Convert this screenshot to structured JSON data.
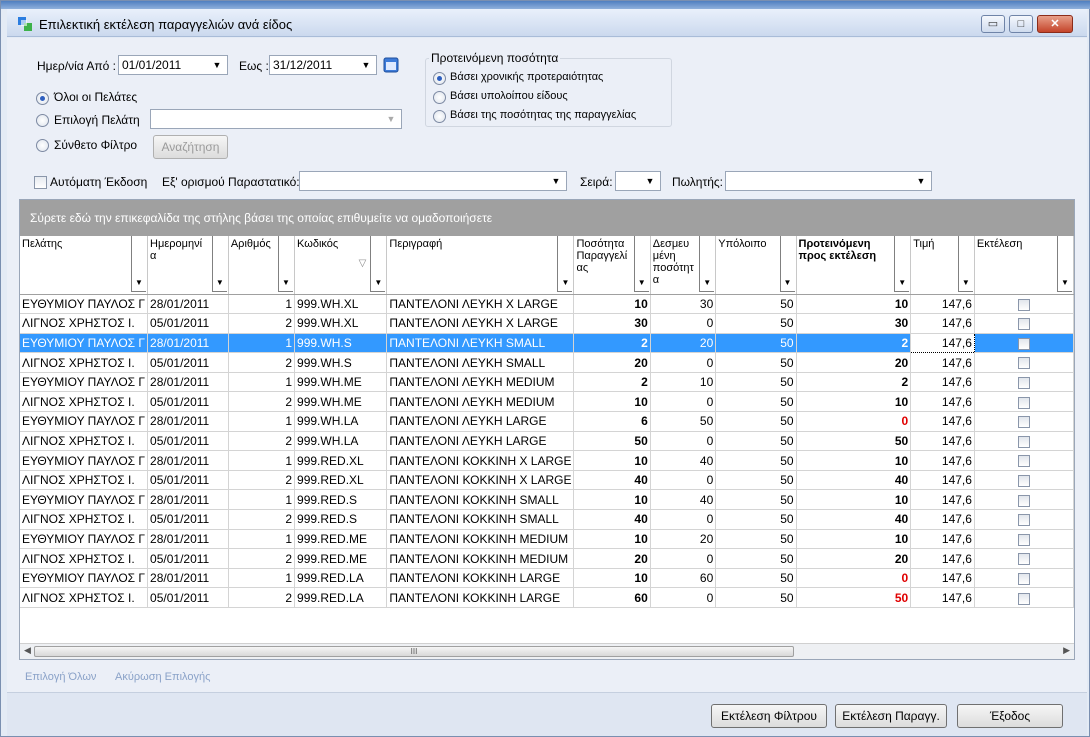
{
  "window": {
    "title": "Επιλεκτική εκτέλεση παραγγελιών ανά είδος",
    "buttons": {
      "minimize": "▭",
      "maximize": "□",
      "close": "✕"
    }
  },
  "filters": {
    "date_from_label": "Ημερ/νία Από :",
    "date_from": "01/01/2011",
    "date_to_label": "Εως :",
    "date_to": "31/12/2011",
    "customer_options": [
      {
        "label": "Όλοι οι Πελάτες",
        "selected": true
      },
      {
        "label": "Επιλογή Πελάτη",
        "selected": false
      },
      {
        "label": "Σύνθετο Φίλτρο",
        "selected": false
      }
    ],
    "customer_select": "",
    "search_button": "Αναζήτηση",
    "auto_issue_label": "Αυτόματη Έκδοση",
    "doc_label": "Εξ' ορισμού Παραστατικό:",
    "doc_value": "",
    "series_label": "Σειρά:",
    "series_value": "",
    "seller_label": "Πωλητής:",
    "seller_value": ""
  },
  "proposed_qty": {
    "legend": "Προτεινόμενη ποσότητα",
    "options": [
      {
        "label": "Βάσει χρονικής προτεραιότητας",
        "selected": true
      },
      {
        "label": "Βάσει υπολοίπου είδους",
        "selected": false
      },
      {
        "label": "Βάσει της ποσότητας της παραγγελίας",
        "selected": false
      }
    ]
  },
  "grid": {
    "group_hint": "Σύρετε εδώ την επικεφαλίδα της στήλης βάσει της οποίας επιθυμείτε να ομαδοποιήσετε",
    "columns": [
      "Πελάτης",
      "Ημερομηνί α",
      "Αριθμός",
      "Κωδικός",
      "Περιγραφή",
      "Ποσότητα Παραγγελί ας",
      "Δεσμευ μένη ποσότητ α",
      "Υπόλοιπο",
      "Προτεινόμενη προς εκτέλεση",
      "Τιμή",
      "Εκτέλεση"
    ],
    "sort_indicator": "▽",
    "rows": [
      {
        "customer": "ΕΥΘΥΜΙΟΥ ΠΑΥΛΟΣ Γ",
        "date": "28/01/2011",
        "num": "1",
        "code": "999.WH.XL",
        "desc": "ΠΑΝΤΕΛΟΝΙ ΛΕΥΚΗ X LARGE",
        "qty": "10",
        "reserved": "30",
        "balance": "50",
        "proposed": "10",
        "price": "147,6",
        "proposed_red": false,
        "selected": false
      },
      {
        "customer": "ΛΙΓΝΟΣ ΧΡΗΣΤΟΣ Ι.",
        "date": "05/01/2011",
        "num": "2",
        "code": "999.WH.XL",
        "desc": "ΠΑΝΤΕΛΟΝΙ ΛΕΥΚΗ X LARGE",
        "qty": "30",
        "reserved": "0",
        "balance": "50",
        "proposed": "30",
        "price": "147,6",
        "proposed_red": false,
        "selected": false
      },
      {
        "customer": "ΕΥΘΥΜΙΟΥ ΠΑΥΛΟΣ Γ",
        "date": "28/01/2011",
        "num": "1",
        "code": "999.WH.S",
        "desc": "ΠΑΝΤΕΛΟΝΙ ΛΕΥΚΗ SMALL",
        "qty": "2",
        "reserved": "20",
        "balance": "50",
        "proposed": "2",
        "price": "147,6",
        "proposed_red": false,
        "selected": true
      },
      {
        "customer": "ΛΙΓΝΟΣ ΧΡΗΣΤΟΣ Ι.",
        "date": "05/01/2011",
        "num": "2",
        "code": "999.WH.S",
        "desc": "ΠΑΝΤΕΛΟΝΙ ΛΕΥΚΗ SMALL",
        "qty": "20",
        "reserved": "0",
        "balance": "50",
        "proposed": "20",
        "price": "147,6",
        "proposed_red": false,
        "selected": false
      },
      {
        "customer": "ΕΥΘΥΜΙΟΥ ΠΑΥΛΟΣ Γ",
        "date": "28/01/2011",
        "num": "1",
        "code": "999.WH.ME",
        "desc": "ΠΑΝΤΕΛΟΝΙ ΛΕΥΚΗ MEDIUM",
        "qty": "2",
        "reserved": "10",
        "balance": "50",
        "proposed": "2",
        "price": "147,6",
        "proposed_red": false,
        "selected": false
      },
      {
        "customer": "ΛΙΓΝΟΣ ΧΡΗΣΤΟΣ Ι.",
        "date": "05/01/2011",
        "num": "2",
        "code": "999.WH.ME",
        "desc": "ΠΑΝΤΕΛΟΝΙ ΛΕΥΚΗ MEDIUM",
        "qty": "10",
        "reserved": "0",
        "balance": "50",
        "proposed": "10",
        "price": "147,6",
        "proposed_red": false,
        "selected": false
      },
      {
        "customer": "ΕΥΘΥΜΙΟΥ ΠΑΥΛΟΣ Γ",
        "date": "28/01/2011",
        "num": "1",
        "code": "999.WH.LA",
        "desc": "ΠΑΝΤΕΛΟΝΙ ΛΕΥΚΗ LARGE",
        "qty": "6",
        "reserved": "50",
        "balance": "50",
        "proposed": "0",
        "price": "147,6",
        "proposed_red": true,
        "selected": false
      },
      {
        "customer": "ΛΙΓΝΟΣ ΧΡΗΣΤΟΣ Ι.",
        "date": "05/01/2011",
        "num": "2",
        "code": "999.WH.LA",
        "desc": "ΠΑΝΤΕΛΟΝΙ ΛΕΥΚΗ LARGE",
        "qty": "50",
        "reserved": "0",
        "balance": "50",
        "proposed": "50",
        "price": "147,6",
        "proposed_red": false,
        "selected": false
      },
      {
        "customer": "ΕΥΘΥΜΙΟΥ ΠΑΥΛΟΣ Γ",
        "date": "28/01/2011",
        "num": "1",
        "code": "999.RED.XL",
        "desc": "ΠΑΝΤΕΛΟΝΙ ΚΟΚΚΙΝΗ X LARGE",
        "qty": "10",
        "reserved": "40",
        "balance": "50",
        "proposed": "10",
        "price": "147,6",
        "proposed_red": false,
        "selected": false
      },
      {
        "customer": "ΛΙΓΝΟΣ ΧΡΗΣΤΟΣ Ι.",
        "date": "05/01/2011",
        "num": "2",
        "code": "999.RED.XL",
        "desc": "ΠΑΝΤΕΛΟΝΙ ΚΟΚΚΙΝΗ X LARGE",
        "qty": "40",
        "reserved": "0",
        "balance": "50",
        "proposed": "40",
        "price": "147,6",
        "proposed_red": false,
        "selected": false
      },
      {
        "customer": "ΕΥΘΥΜΙΟΥ ΠΑΥΛΟΣ Γ",
        "date": "28/01/2011",
        "num": "1",
        "code": "999.RED.S",
        "desc": "ΠΑΝΤΕΛΟΝΙ ΚΟΚΚΙΝΗ SMALL",
        "qty": "10",
        "reserved": "40",
        "balance": "50",
        "proposed": "10",
        "price": "147,6",
        "proposed_red": false,
        "selected": false
      },
      {
        "customer": "ΛΙΓΝΟΣ ΧΡΗΣΤΟΣ Ι.",
        "date": "05/01/2011",
        "num": "2",
        "code": "999.RED.S",
        "desc": "ΠΑΝΤΕΛΟΝΙ ΚΟΚΚΙΝΗ SMALL",
        "qty": "40",
        "reserved": "0",
        "balance": "50",
        "proposed": "40",
        "price": "147,6",
        "proposed_red": false,
        "selected": false
      },
      {
        "customer": "ΕΥΘΥΜΙΟΥ ΠΑΥΛΟΣ Γ",
        "date": "28/01/2011",
        "num": "1",
        "code": "999.RED.ME",
        "desc": "ΠΑΝΤΕΛΟΝΙ ΚΟΚΚΙΝΗ MEDIUM",
        "qty": "10",
        "reserved": "20",
        "balance": "50",
        "proposed": "10",
        "price": "147,6",
        "proposed_red": false,
        "selected": false
      },
      {
        "customer": "ΛΙΓΝΟΣ ΧΡΗΣΤΟΣ Ι.",
        "date": "05/01/2011",
        "num": "2",
        "code": "999.RED.ME",
        "desc": "ΠΑΝΤΕΛΟΝΙ ΚΟΚΚΙΝΗ MEDIUM",
        "qty": "20",
        "reserved": "0",
        "balance": "50",
        "proposed": "20",
        "price": "147,6",
        "proposed_red": false,
        "selected": false
      },
      {
        "customer": "ΕΥΘΥΜΙΟΥ ΠΑΥΛΟΣ Γ",
        "date": "28/01/2011",
        "num": "1",
        "code": "999.RED.LA",
        "desc": "ΠΑΝΤΕΛΟΝΙ ΚΟΚΚΙΝΗ LARGE",
        "qty": "10",
        "reserved": "60",
        "balance": "50",
        "proposed": "0",
        "price": "147,6",
        "proposed_red": true,
        "selected": false
      },
      {
        "customer": "ΛΙΓΝΟΣ ΧΡΗΣΤΟΣ Ι.",
        "date": "05/01/2011",
        "num": "2",
        "code": "999.RED.LA",
        "desc": "ΠΑΝΤΕΛΟΝΙ ΚΟΚΚΙΝΗ LARGE",
        "qty": "60",
        "reserved": "0",
        "balance": "50",
        "proposed": "50",
        "price": "147,6",
        "proposed_red": true,
        "selected": false
      }
    ],
    "scroll_grip": "III"
  },
  "links": {
    "select_all": "Επιλογή Όλων",
    "cancel_selection": "Ακύρωση Επιλογής"
  },
  "actions": {
    "run_filter": "Εκτέλεση Φίλτρου",
    "run_order": "Εκτέλεση Παραγγ.",
    "exit": "Έξοδος"
  },
  "colors": {
    "selection": "#3399ff",
    "negative": "#e00000",
    "group_band": "#a0a0a0"
  }
}
